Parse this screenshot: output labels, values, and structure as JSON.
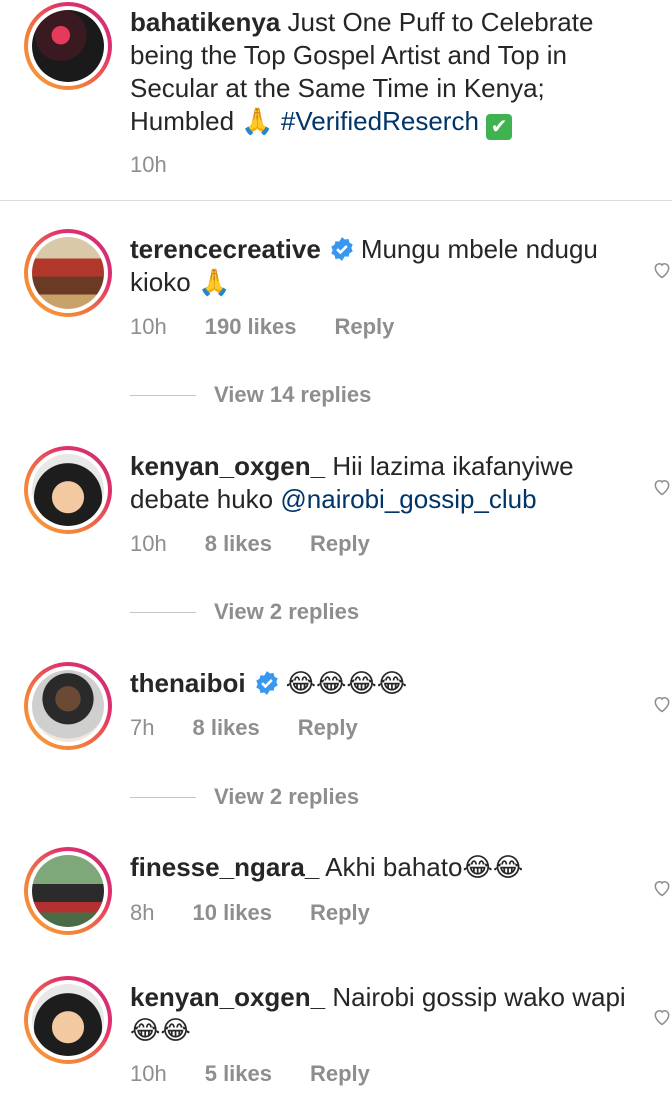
{
  "caption": {
    "username": "bahatikenya",
    "text": "Just One Puff to Celebrate being the Top Gospel Artist and Top in Secular at the Same Time in Kenya; Humbled",
    "emoji": "🙏",
    "hashtag": "#VerifiedReserch",
    "check_emoji": "✔",
    "time": "10h"
  },
  "comments": [
    {
      "username": "terencecreative",
      "verified": true,
      "text": "Mungu mbele ndugu kioko",
      "emoji": "🙏",
      "time": "10h",
      "likes": "190 likes",
      "reply": "Reply",
      "view_replies": "View 14 replies"
    },
    {
      "username": "kenyan_oxgen_",
      "verified": false,
      "text": "Hii lazima ikafanyiwe debate huko",
      "mention": "@nairobi_gossip_club",
      "time": "10h",
      "likes": "8 likes",
      "reply": "Reply",
      "view_replies": "View 2 replies"
    },
    {
      "username": "thenaiboi",
      "verified": true,
      "emoji": "😂😂😂😂",
      "time": "7h",
      "likes": "8 likes",
      "reply": "Reply",
      "view_replies": "View 2 replies"
    },
    {
      "username": "finesse_ngara_",
      "verified": false,
      "text": "Akhi bahato",
      "emoji": "😂😂",
      "time": "8h",
      "likes": "10 likes",
      "reply": "Reply"
    },
    {
      "username": "kenyan_oxgen_",
      "verified": false,
      "text": "Nairobi gossip wako wapi",
      "emoji": "😂😂",
      "time": "10h",
      "likes": "5 likes",
      "reply": "Reply"
    }
  ],
  "colors": {
    "link": "#003569",
    "meta": "#8e8e8e",
    "verified": "#3897f0"
  }
}
